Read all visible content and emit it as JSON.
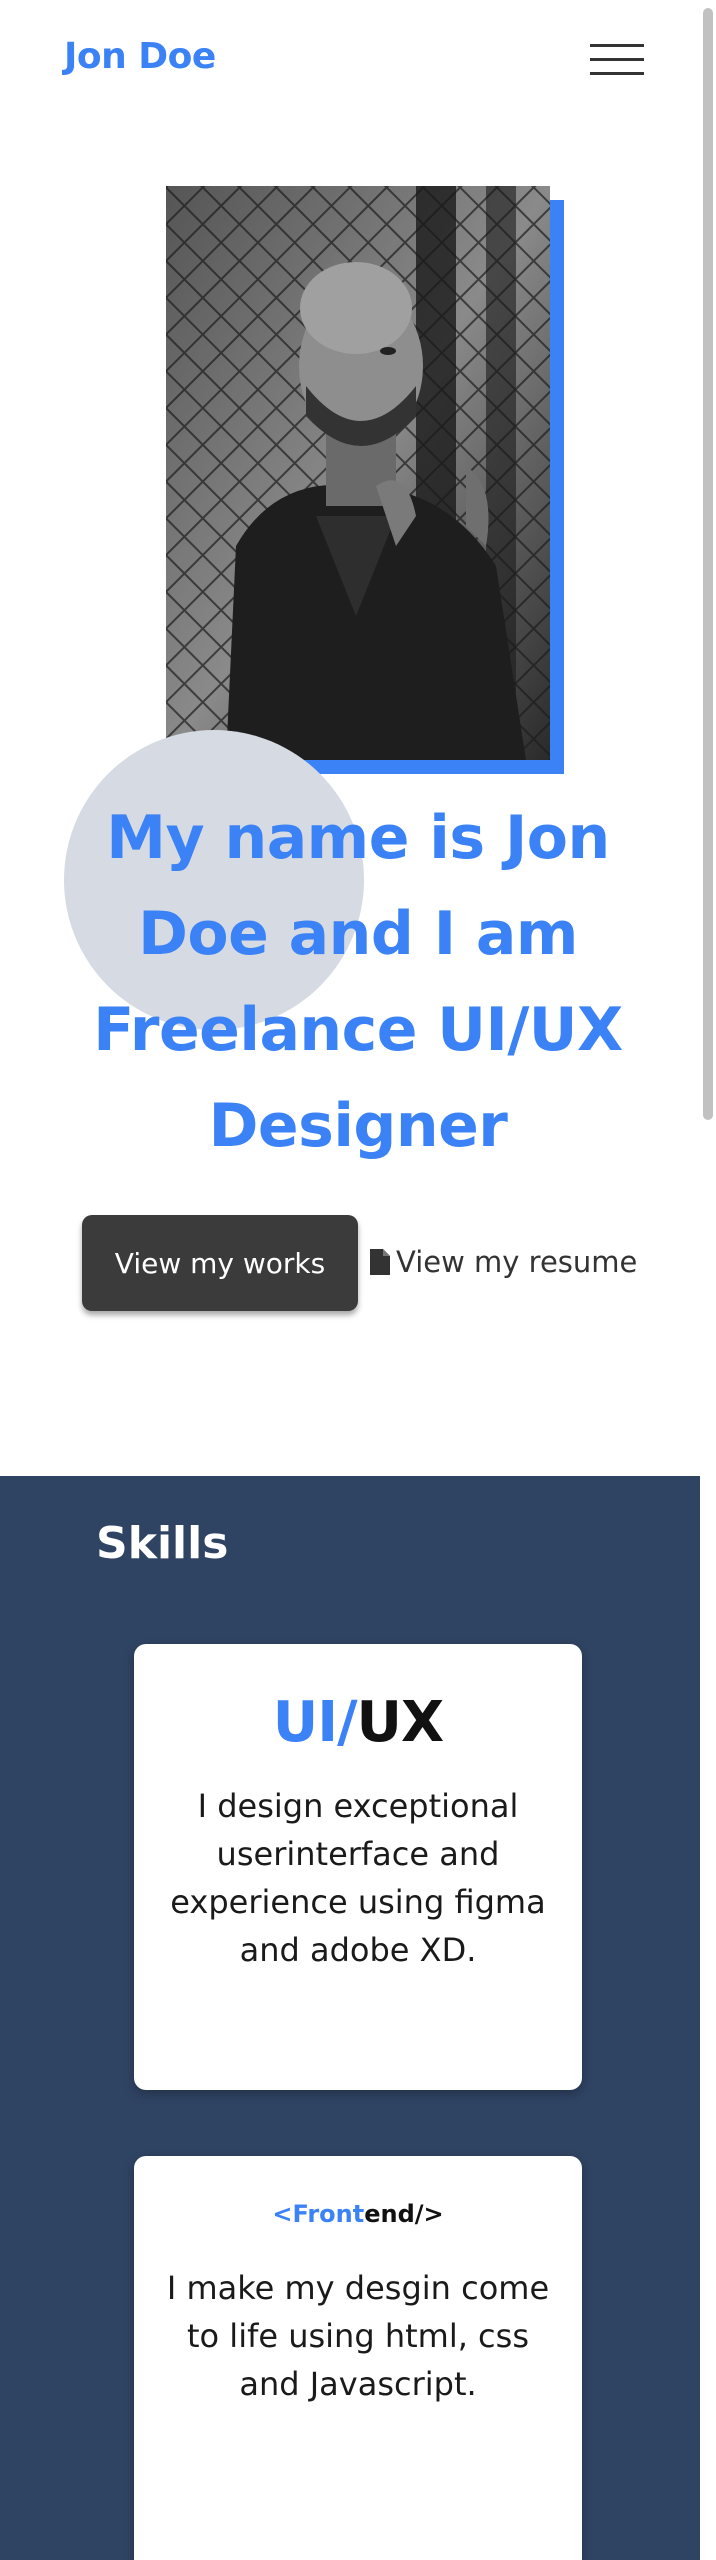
{
  "header": {
    "logo": "Jon Doe",
    "menu_icon": "hamburger-menu-icon"
  },
  "hero": {
    "photo_alt": "portrait-photo",
    "title": "My name is Jon Doe and I am Freelance UI/UX Designer",
    "primary_button": "View my works",
    "secondary_button": "View my resume",
    "secondary_icon": "file-icon",
    "accent_color": "#3b82f6"
  },
  "skills": {
    "title": "Skills",
    "background_color": "#2f4363",
    "cards": [
      {
        "heading_part1": "UI/",
        "heading_part2": "UX",
        "text": "I design exceptional userinterface and experience using figma and adobe XD."
      },
      {
        "heading_part1": "<Front",
        "heading_part2": "end/>",
        "text": "I make my desgin come to life using html, css and Javascript."
      }
    ]
  }
}
